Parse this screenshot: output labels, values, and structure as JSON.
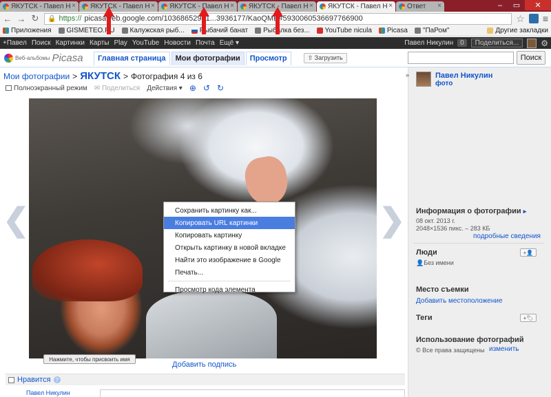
{
  "browser": {
    "tabs": [
      {
        "title": "ЯКУТСК - Павел Н",
        "active": false
      },
      {
        "title": "ЯКУТСК - Павел Н",
        "active": false
      },
      {
        "title": "ЯКУТСК - Павел Н",
        "active": false
      },
      {
        "title": "ЯКУТСК - Павел Н",
        "active": false
      },
      {
        "title": "ЯКУТСК - Павел Н",
        "active": true
      },
      {
        "title": "Ответ",
        "active": false
      }
    ],
    "url_scheme": "https://",
    "url_rest": "picasaweb.google.com/10368652941...3936177/KaoQME#5930060536697766900",
    "window_controls": {
      "min": "–",
      "max": "▭",
      "close": "✕"
    }
  },
  "bookmarks": [
    {
      "label": "Приложения",
      "icon": "apps-icon"
    },
    {
      "label": "GISMETEO.RU",
      "icon": "bookmark-icon"
    },
    {
      "label": "Калужская рыб...",
      "icon": "bookmark-icon"
    },
    {
      "label": "Рыбачий банат",
      "icon": "flag-icon"
    },
    {
      "label": "Рыбалка без...",
      "icon": "bookmark-icon"
    },
    {
      "label": "YouTube nicula",
      "icon": "youtube-icon"
    },
    {
      "label": "Picasa",
      "icon": "picasa-icon"
    },
    {
      "label": "\"ПаРом\"",
      "icon": "bookmark-icon"
    }
  ],
  "bookmarks_other": "Другие закладки",
  "gbar": {
    "links": [
      "+Павел",
      "Поиск",
      "Картинки",
      "Карты",
      "Play",
      "YouTube",
      "Новости",
      "Почта",
      "Ещё ▾"
    ],
    "user": "Павел Никулин",
    "count": "0",
    "share": "Поделиться..."
  },
  "picasa": {
    "logo_small": "Веб-альбомы",
    "logo_name": "Picasa",
    "tabs": [
      "Главная страница",
      "Мои фотографии",
      "Просмотр"
    ],
    "active_tab": 1,
    "upload": "Загрузить",
    "search_button": "Поиск"
  },
  "breadcrumb": {
    "root": "Мои фотографии",
    "sep": ">",
    "album": "ЯКУТСК",
    "position": "Фотография 4 из 6"
  },
  "actions": {
    "fullscreen": "Полноэкранный режим",
    "share": "Поделиться",
    "actions": "Действия ▾"
  },
  "photo": {
    "name_button": "Нажмите, чтобы присвоить имя",
    "add_caption": "Добавить подпись"
  },
  "context_menu": [
    {
      "label": "Сохранить картинку как...",
      "highlighted": false
    },
    {
      "label": "Копировать URL картинки",
      "highlighted": true
    },
    {
      "label": "Копировать картинку",
      "highlighted": false
    },
    {
      "label": "Открыть картинку в новой вкладке",
      "highlighted": false
    },
    {
      "label": "Найти это изображение в Google",
      "highlighted": false
    },
    {
      "label": "Печать...",
      "highlighted": false
    },
    {
      "label": "Просмотр кода элемента",
      "highlighted": false
    }
  ],
  "likes": {
    "label": "Нравится",
    "help": "?",
    "commenter": "Павел Никулин"
  },
  "sidebar": {
    "owner_name": "Павел Никулин",
    "owner_sub": "фото",
    "info_title": "Информация о фотографии",
    "info_date": "08 окт. 2013 г.",
    "info_size": "2048×1536 пикс. – 283 КБ",
    "info_link": "подробные сведения",
    "people_title": "Люди",
    "people_value": "Без имени",
    "place_title": "Место съемки",
    "place_link": "Добавить местоположение",
    "tags_title": "Теги",
    "usage_title": "Использование фотографий",
    "usage_value": "Все права защищены",
    "usage_link": "изменить"
  },
  "colors": {
    "tabstrip": "#8a1f2a",
    "link": "#1155cc",
    "menu_highlight": "#4a7de0",
    "annotation_arrow": "#e11b1b"
  }
}
